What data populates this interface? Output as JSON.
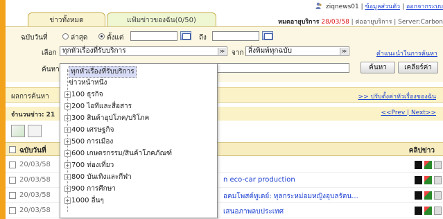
{
  "header": {
    "username": "ziqnews01",
    "personal_info_link": "ข้อมูลส่วนตัว",
    "logout_link": "ออกจากระบบ",
    "status_label": "หมดอายุบริการ",
    "status_date": "28/03/58",
    "status_extra": "| ต่ออายุบริการ | Server:Carbon"
  },
  "tabs": [
    {
      "label": "ข่าวทั้งหมด"
    },
    {
      "label": "แฟ้มข่าวของฉัน(0/50)"
    }
  ],
  "search": {
    "date_label": "ฉบับวันที่",
    "radio_latest": "ล่าสุด",
    "radio_since": "ตั้งแต่",
    "to_label": "ถึง",
    "select_label": "เลือก",
    "category_value": "ทุกหัวเรื่องที่รับบริการ",
    "from_label": "จาก",
    "source_value": "สิ่งพิมพ์ทุกฉบับ",
    "help_link": "คำแนะนำในการค้นหา",
    "keyword_label": "ค้นหา",
    "search_button": "ค้นหา",
    "clear_button": "เคลียร์ค่า"
  },
  "results": {
    "label": "ผลการค้นหา",
    "adjust_link": ">> ปรับตั้งค่าหัวเรื่องของฉัน",
    "count_label": "จำนวนข่าว: 21",
    "pager": "<<Prev | Next>>"
  },
  "table": {
    "col_date": "ฉบับวันที่",
    "col_clip": "คลิปข่าว",
    "rows": [
      {
        "date": "20/03/58",
        "title": ""
      },
      {
        "date": "20/03/58",
        "title": "n eco-car production"
      },
      {
        "date": "20/03/58",
        "title": "อคมโพสต์ทูเดย์: ทุลกระหม่อมหญิงอุบลรัตน..."
      },
      {
        "date": "20/03/58",
        "title": "เสนอภาพลบประเทศ"
      }
    ]
  },
  "dropdown": {
    "items": [
      {
        "label": "ทุกหัวเรื่องที่รับบริการ",
        "expandable": false,
        "selected": true
      },
      {
        "label": "ข่าวหน้าหนึ่ง",
        "expandable": false,
        "selected": false
      },
      {
        "label": "100 ธุรกิจ",
        "expandable": true,
        "selected": false
      },
      {
        "label": "200 ไอทีและสื่อสาร",
        "expandable": true,
        "selected": false
      },
      {
        "label": "300 สินค้าอุปโภค/บริโภค",
        "expandable": true,
        "selected": false
      },
      {
        "label": "400 เศรษฐกิจ",
        "expandable": true,
        "selected": false
      },
      {
        "label": "500 การเมือง",
        "expandable": true,
        "selected": false
      },
      {
        "label": "600 เกษตรกรรม/สินค้าโภคภัณฑ์",
        "expandable": true,
        "selected": false
      },
      {
        "label": "700 ท่องเที่ยว",
        "expandable": true,
        "selected": false
      },
      {
        "label": "800 บันเทิงและกีฬา",
        "expandable": true,
        "selected": false
      },
      {
        "label": "900 การศึกษา",
        "expandable": true,
        "selected": false
      },
      {
        "label": "1000 อื่นๆ",
        "expandable": true,
        "selected": false
      }
    ]
  }
}
